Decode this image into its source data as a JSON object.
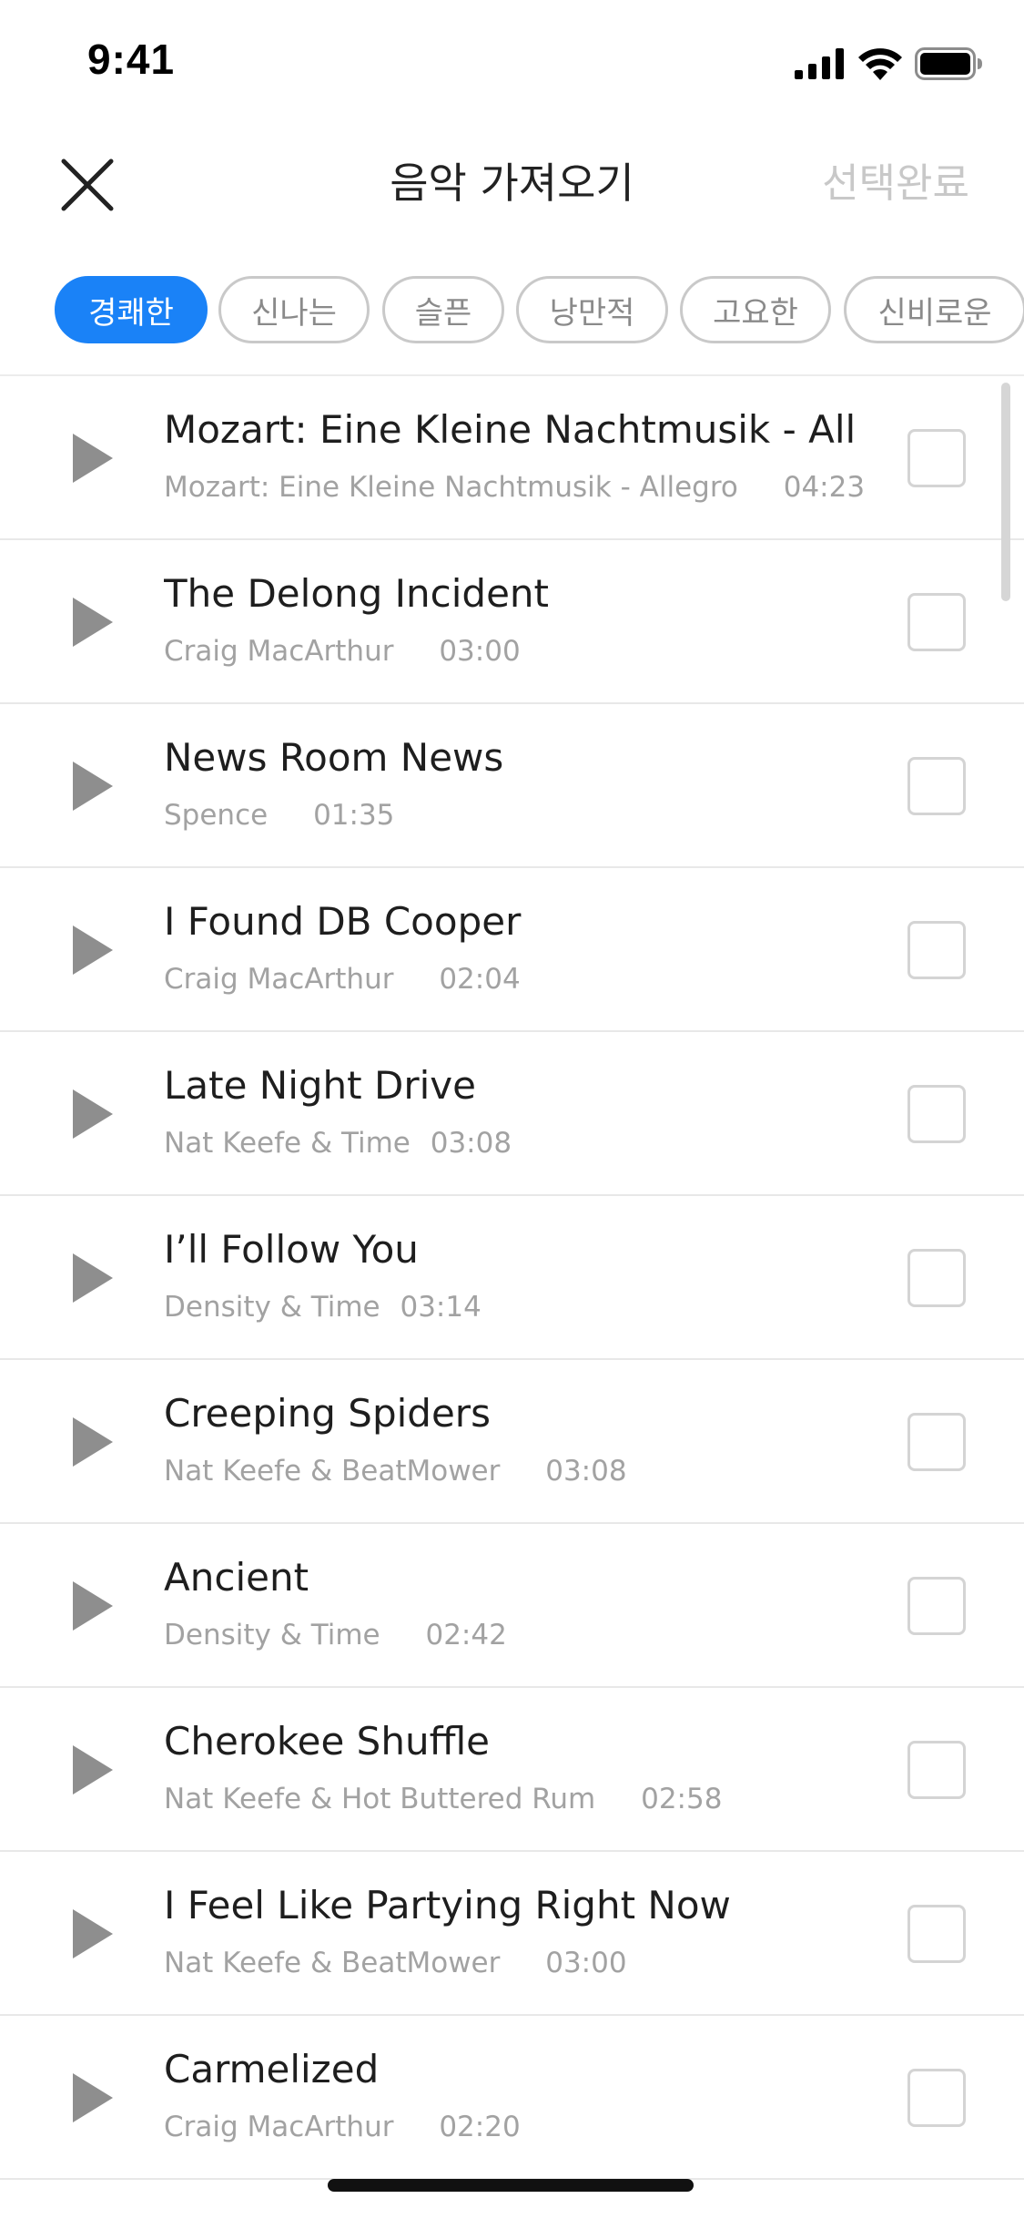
{
  "status_bar": {
    "time": "9:41",
    "icons": [
      "cellular-signal-icon",
      "wifi-icon",
      "battery-icon"
    ]
  },
  "header": {
    "close_icon": "close-icon",
    "title": "음악 가져오기",
    "done_label": "선택완료"
  },
  "colors": {
    "accent": "#1a82f7",
    "chip_border": "#c9c9c9",
    "play_icon": "#8e8e8e",
    "meta_text": "#a2a2a2",
    "done_disabled": "#c8c8c8"
  },
  "moods": [
    {
      "label": "경쾌한",
      "selected": true
    },
    {
      "label": "신나는",
      "selected": false
    },
    {
      "label": "슬픈",
      "selected": false
    },
    {
      "label": "낭만적",
      "selected": false
    },
    {
      "label": "고요한",
      "selected": false
    },
    {
      "label": "신비로운",
      "selected": false
    }
  ],
  "tracks": [
    {
      "title": "Mozart: Eine Kleine Nachtmusik - Allegro",
      "artist": "Mozart: Eine Kleine Nachtmusik - Allegro",
      "duration": "04:23",
      "checked": false
    },
    {
      "title": "The Delong Incident",
      "artist": "Craig MacArthur",
      "duration": "03:00",
      "checked": false
    },
    {
      "title": "News Room News",
      "artist": "Spence",
      "duration": "01:35",
      "checked": false
    },
    {
      "title": "I Found DB Cooper",
      "artist": "Craig MacArthur",
      "duration": "02:04",
      "checked": false
    },
    {
      "title": "Late Night Drive",
      "artist": "Nat Keefe & Time",
      "duration": "03:08",
      "checked": false
    },
    {
      "title": "I’ll Follow You",
      "artist": "Density & Time",
      "duration": "03:14",
      "checked": false
    },
    {
      "title": "Creeping Spiders",
      "artist": "Nat Keefe & BeatMower",
      "duration": "03:08",
      "checked": false
    },
    {
      "title": "Ancient",
      "artist": "Density & Time",
      "duration": "02:42",
      "checked": false
    },
    {
      "title": "Cherokee Shuffle",
      "artist": "Nat Keefe & Hot Buttered Rum",
      "duration": "02:58",
      "checked": false
    },
    {
      "title": "I Feel Like Partying Right Now",
      "artist": "Nat Keefe & BeatMower",
      "duration": "03:00",
      "checked": false
    },
    {
      "title": "Carmelized",
      "artist": "Craig MacArthur",
      "duration": "02:20",
      "checked": false
    }
  ]
}
